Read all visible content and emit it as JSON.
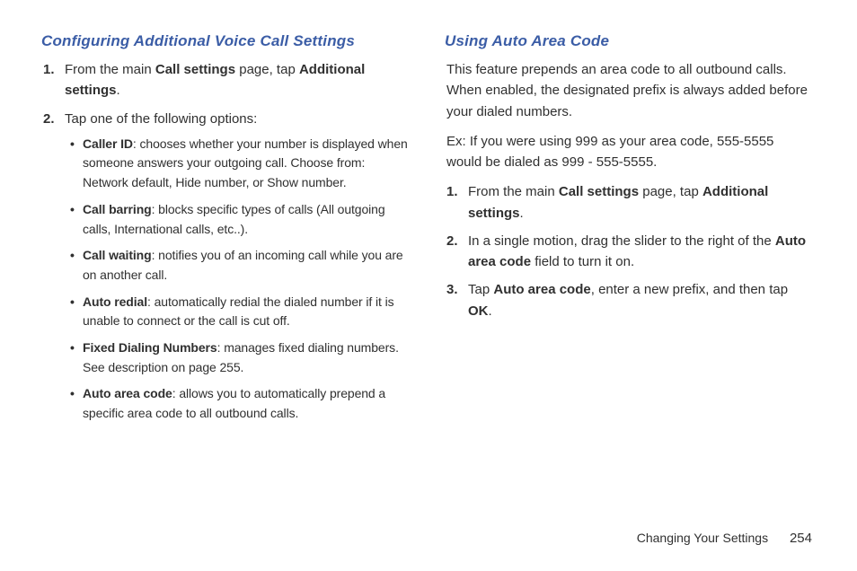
{
  "left": {
    "heading": "Configuring Additional Voice Call Settings",
    "items": [
      {
        "num": "1.",
        "parts": [
          {
            "t": "From the main ",
            "b": false
          },
          {
            "t": "Call settings",
            "b": true
          },
          {
            "t": " page, tap ",
            "b": false
          },
          {
            "t": "Additional settings",
            "b": true
          },
          {
            "t": ".",
            "b": false
          }
        ]
      },
      {
        "num": "2.",
        "parts": [
          {
            "t": "Tap one of the following options:",
            "b": false
          }
        ],
        "bullets": [
          [
            {
              "t": "Caller ID",
              "b": true
            },
            {
              "t": ": chooses whether your number is displayed when someone answers your outgoing call. Choose from: Network default, Hide number, or Show number.",
              "b": false
            }
          ],
          [
            {
              "t": "Call barring",
              "b": true
            },
            {
              "t": ": blocks specific types of calls (All outgoing calls, International calls, etc..).",
              "b": false
            }
          ],
          [
            {
              "t": "Call waiting",
              "b": true
            },
            {
              "t": ": notifies you of an incoming call while you are on another call.",
              "b": false
            }
          ],
          [
            {
              "t": "Auto redial",
              "b": true
            },
            {
              "t": ": automatically redial the dialed number if it is unable to connect or the call is cut off.",
              "b": false
            }
          ],
          [
            {
              "t": "Fixed Dialing Numbers",
              "b": true
            },
            {
              "t": ": manages fixed dialing numbers. See description on page 255.",
              "b": false
            }
          ],
          [
            {
              "t": "Auto area code",
              "b": true
            },
            {
              "t": ": allows you to automatically prepend a specific area code to all outbound calls.",
              "b": false
            }
          ]
        ]
      }
    ]
  },
  "right": {
    "heading": "Using Auto Area Code",
    "paras": [
      "This feature prepends an area code to all outbound calls. When enabled, the designated prefix is always added before your dialed numbers.",
      "Ex: If you were using 999 as your area code, 555-5555 would be dialed as 999 - 555-5555."
    ],
    "items": [
      {
        "num": "1.",
        "parts": [
          {
            "t": "From the main ",
            "b": false
          },
          {
            "t": "Call settings",
            "b": true
          },
          {
            "t": " page, tap ",
            "b": false
          },
          {
            "t": "Additional settings",
            "b": true
          },
          {
            "t": ".",
            "b": false
          }
        ]
      },
      {
        "num": "2.",
        "parts": [
          {
            "t": "In a single motion, drag the slider to the right of the ",
            "b": false
          },
          {
            "t": "Auto area code",
            "b": true
          },
          {
            "t": " field to turn it on.",
            "b": false
          }
        ]
      },
      {
        "num": "3.",
        "parts": [
          {
            "t": "Tap ",
            "b": false
          },
          {
            "t": "Auto area code",
            "b": true
          },
          {
            "t": ", enter a new prefix, and then tap ",
            "b": false
          },
          {
            "t": "OK",
            "b": true
          },
          {
            "t": ".",
            "b": false
          }
        ]
      }
    ]
  },
  "footer": {
    "title": "Changing Your Settings",
    "page": "254"
  }
}
